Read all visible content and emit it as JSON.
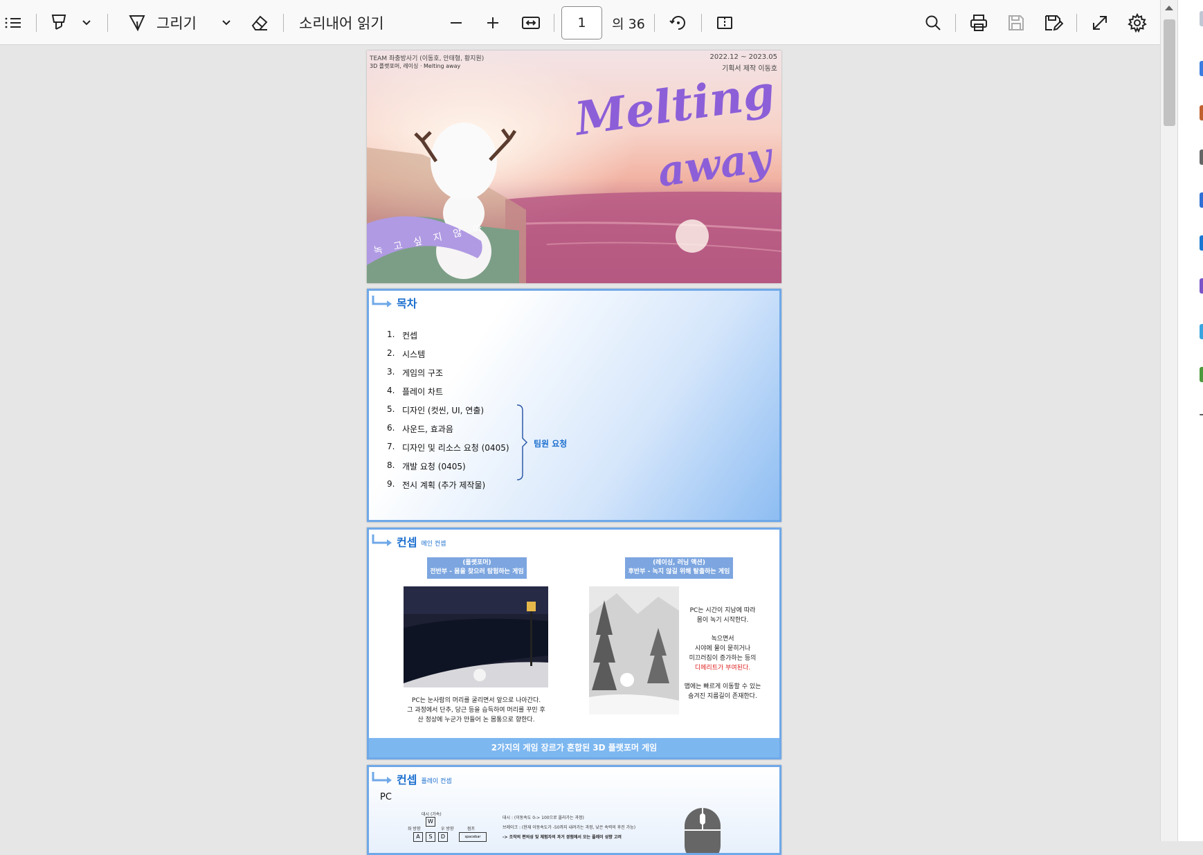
{
  "toolbar": {
    "draw_label": "그리기",
    "read_aloud_label": "소리내어 읽기",
    "page_current": "1",
    "page_total": "의 36"
  },
  "slide1": {
    "team_line": "TEAM 좌충방사기 (이동호, 안태형, 황지원)",
    "genre_line": "3D 플랫포머, 레이싱 · Melting away",
    "date": "2022.12 ~ 2023.05",
    "author": "기획서 제작 이동호",
    "title_line1": "Melting",
    "title_line2": "away",
    "ribbon_text": "녹 고 싶 지 않 아"
  },
  "slide2": {
    "title": "목차",
    "items": [
      {
        "num": "1.",
        "text": "컨셉"
      },
      {
        "num": "2.",
        "text": "시스템"
      },
      {
        "num": "3.",
        "text": "게임의 구조"
      },
      {
        "num": "4.",
        "text": "플레이 차트"
      },
      {
        "num": "5.",
        "text": "디자인 (컷씬, UI, 연출)"
      },
      {
        "num": "6.",
        "text": "사운드, 효과음"
      },
      {
        "num": "7.",
        "text": "디자인 및 리소스 요청 (0405)"
      },
      {
        "num": "8.",
        "text": "개발 요청 (0405)"
      },
      {
        "num": "9.",
        "text": "전시 계획 (추가 제작물)"
      }
    ],
    "bracket_label": "팀원 요청"
  },
  "slide3": {
    "title": "컨셉",
    "subtitle": "메인 컨셉",
    "left_box_l1": "(플랫포머)",
    "left_box_l2": "전반부 - 몸을 찾으러 탐험하는 게임",
    "right_box_l1": "(레이싱, 러닝 액션)",
    "right_box_l2": "후반부 - 녹지 않길 위해 탈출하는 게임",
    "left_cap1": "PC는 눈사람의 머리를 굴리면서 앞으로 나아간다.",
    "left_cap2": "그 과정에서 단추, 당근 등을 습득하여 머리를 꾸민 후",
    "left_cap3": "산 정상에 누군가 만들어 논 몸통으로 향한다.",
    "right_cap1": "PC는 시간이 지남에 따라",
    "right_cap2": "몸이 녹기 시작한다.",
    "right_cap3": "녹으면서",
    "right_cap4": "시야에 물이 묻히거나",
    "right_cap5": "미끄러짐이 증가하는 등의",
    "right_cap6": "디메리트가 부여된다.",
    "right_cap7": "맵에는 빠르게 이동할 수 있는",
    "right_cap8": "숨겨진 지름길이 존재한다.",
    "banner": "2가지의 게임 장르가 혼합된 3D 플랫포머 게임"
  },
  "slide4": {
    "title": "컨셉",
    "subtitle": "플레이 컨셉",
    "pc_label": "PC",
    "dash_label": "대시 (가속)",
    "left_dir": "좌 방향",
    "right_dir": "우 방향",
    "jump_label": "점프",
    "key_w": "W",
    "key_a": "A",
    "key_s": "S",
    "key_d": "D",
    "key_space": "spacebar",
    "line1": "대시 : (이동속도 0-> 100으로 올라가는 과정)",
    "line2": "브레이크 : (현재 이동속도가 -50까지 내려가는 과정, 낮은 속력의 후진 가능)",
    "line3": "-> 조작의 편의성 및 체험자의 과거 경험에서 오는 플레이 성향 고려"
  }
}
